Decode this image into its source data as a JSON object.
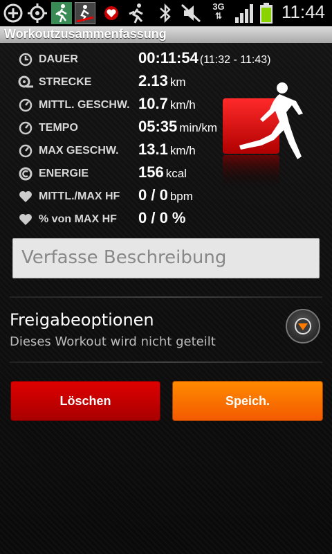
{
  "status_bar": {
    "time": "11:44",
    "network": "3G",
    "icons": [
      "add-icon",
      "gps-icon",
      "runner-app-icon",
      "treadmill-icon",
      "heart-red-icon",
      "runner-outline-icon",
      "bluetooth-icon",
      "mute-icon",
      "network-3g-icon",
      "signal-icon",
      "battery-icon"
    ]
  },
  "title": "Workoutzusammenfassung",
  "stats": [
    {
      "label": "DAUER",
      "value": "00:11:54",
      "unit": "",
      "extra": "(11:32 - 11:43)",
      "icon": "clock-icon"
    },
    {
      "label": "STRECKE",
      "value": "2.13",
      "unit": "km",
      "extra": "",
      "icon": "distance-icon"
    },
    {
      "label": "MITTL. GESCHW.",
      "value": "10.7",
      "unit": "km/h",
      "extra": "",
      "icon": "speedometer-icon"
    },
    {
      "label": "TEMPO",
      "value": "05:35",
      "unit": "min/km",
      "extra": "",
      "icon": "speedometer-icon"
    },
    {
      "label": "MAX GESCHW.",
      "value": "13.1",
      "unit": "km/h",
      "extra": "",
      "icon": "speedometer-icon"
    },
    {
      "label": "ENERGIE",
      "value": "156",
      "unit": "kcal",
      "extra": "",
      "icon": "calories-icon"
    },
    {
      "label": "MITTL./MAX HF",
      "value": "0 / 0",
      "unit": "bpm",
      "extra": "",
      "icon": "heart-icon"
    },
    {
      "label": "% von MAX HF",
      "value": "0 / 0 %",
      "unit": "",
      "extra": "",
      "icon": "heart-icon"
    }
  ],
  "description": {
    "placeholder": "Verfasse Beschreibung"
  },
  "sharing": {
    "title": "Freigabeoptionen",
    "subtitle": "Dieses Workout wird nicht geteilt"
  },
  "buttons": {
    "delete": "Löschen",
    "save": "Speich."
  },
  "colors": {
    "delete": "#d00000",
    "save": "#ff7a00",
    "accent": "#ff6a00"
  }
}
